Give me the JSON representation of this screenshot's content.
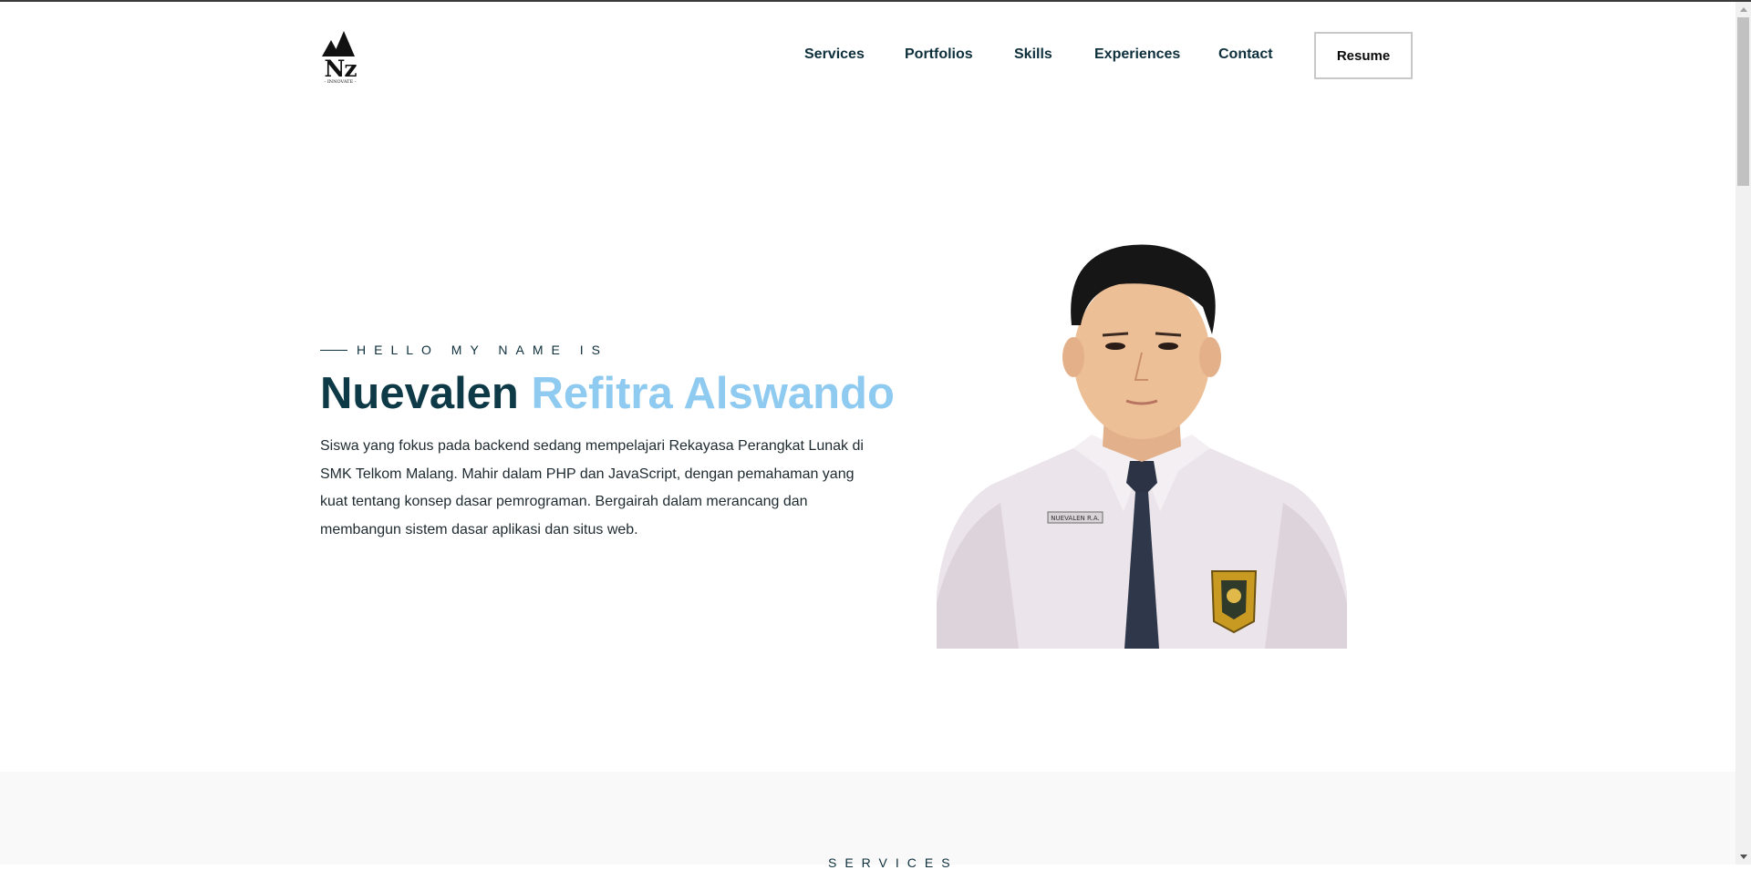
{
  "brand": {
    "logo_text": "Nz",
    "logo_tagline": "- INNOVATE -"
  },
  "nav": {
    "links": [
      "Services",
      "Portfolios",
      "Skills",
      "Experiences",
      "Contact"
    ],
    "resume_label": "Resume"
  },
  "hero": {
    "eyebrow": "HELLO MY NAME IS",
    "name_first": "Nuevalen",
    "name_rest": "Refitra Alswando",
    "bio": "Siswa yang fokus pada backend sedang mempelajari Rekayasa Perangkat Lunak di SMK Telkom Malang. Mahir dalam PHP dan JavaScript, dengan pemahaman yang kuat tentang konsep dasar pemrograman. Bergairah dalam merancang dan membangun sistem dasar aplikasi dan situs web.",
    "portrait_nametag": "NUEVALEN R.A."
  },
  "next_section": {
    "heading": "SERVICES"
  },
  "colors": {
    "navy": "#0e3a47",
    "light_blue": "#8fcaf0",
    "section_bg": "#f9f9f9"
  },
  "icons": {
    "scroll_up": "scroll-up-arrow-icon",
    "scroll_down": "scroll-down-arrow-icon"
  }
}
